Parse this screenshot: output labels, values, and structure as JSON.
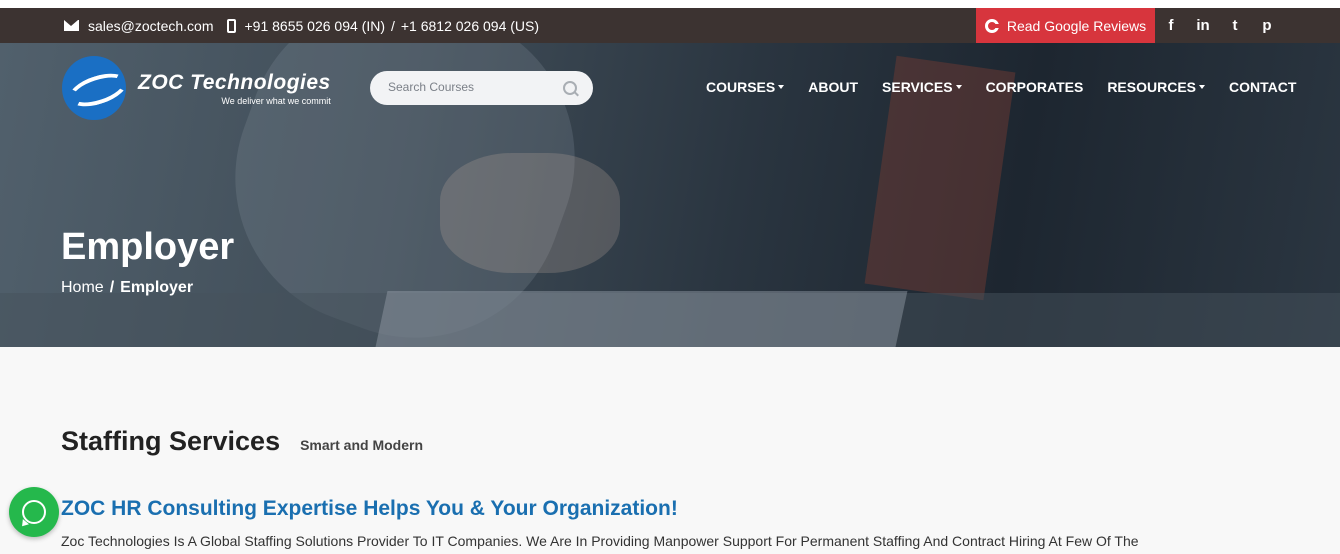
{
  "topbar": {
    "email": "sales@zoctech.com",
    "phone_in": "+91 8655 026 094 (IN)",
    "phone_sep": "/",
    "phone_us": "+1 6812 026 094 (US)",
    "reviews_label": "Read Google Reviews",
    "socials": [
      {
        "icon": "facebook-icon",
        "glyph": "f"
      },
      {
        "icon": "linkedin-icon",
        "glyph": "in"
      },
      {
        "icon": "twitter-icon",
        "glyph": "t"
      },
      {
        "icon": "pinterest-icon",
        "glyph": "p"
      }
    ]
  },
  "header": {
    "logo_title": "ZOC Technologies",
    "logo_tagline": "We deliver what we commit",
    "search_placeholder": "Search Courses",
    "nav": [
      {
        "label": "COURSES",
        "dropdown": true
      },
      {
        "label": "ABOUT",
        "dropdown": false
      },
      {
        "label": "SERVICES",
        "dropdown": true
      },
      {
        "label": "CORPORATES",
        "dropdown": false
      },
      {
        "label": "RESOURCES",
        "dropdown": true
      },
      {
        "label": "CONTACT",
        "dropdown": false
      }
    ]
  },
  "hero": {
    "title": "Employer",
    "breadcrumb_home": "Home",
    "breadcrumb_sep": "/",
    "breadcrumb_current": "Employer"
  },
  "content": {
    "section_title": "Staffing Services",
    "section_subtitle": "Smart and Modern",
    "sub_heading": "ZOC HR Consulting Expertise Helps You & Your Organization!",
    "paragraph": "Zoc Technologies Is A Global Staffing Solutions Provider To IT Companies. We Are In Providing Manpower Support For Permanent Staffing And Contract Hiring At Few Of The"
  },
  "colors": {
    "topbar_bg": "#3c3331",
    "reviews_bg": "#d7353d",
    "link_blue": "#1a6fb0",
    "whatsapp_green": "#25b84c"
  }
}
